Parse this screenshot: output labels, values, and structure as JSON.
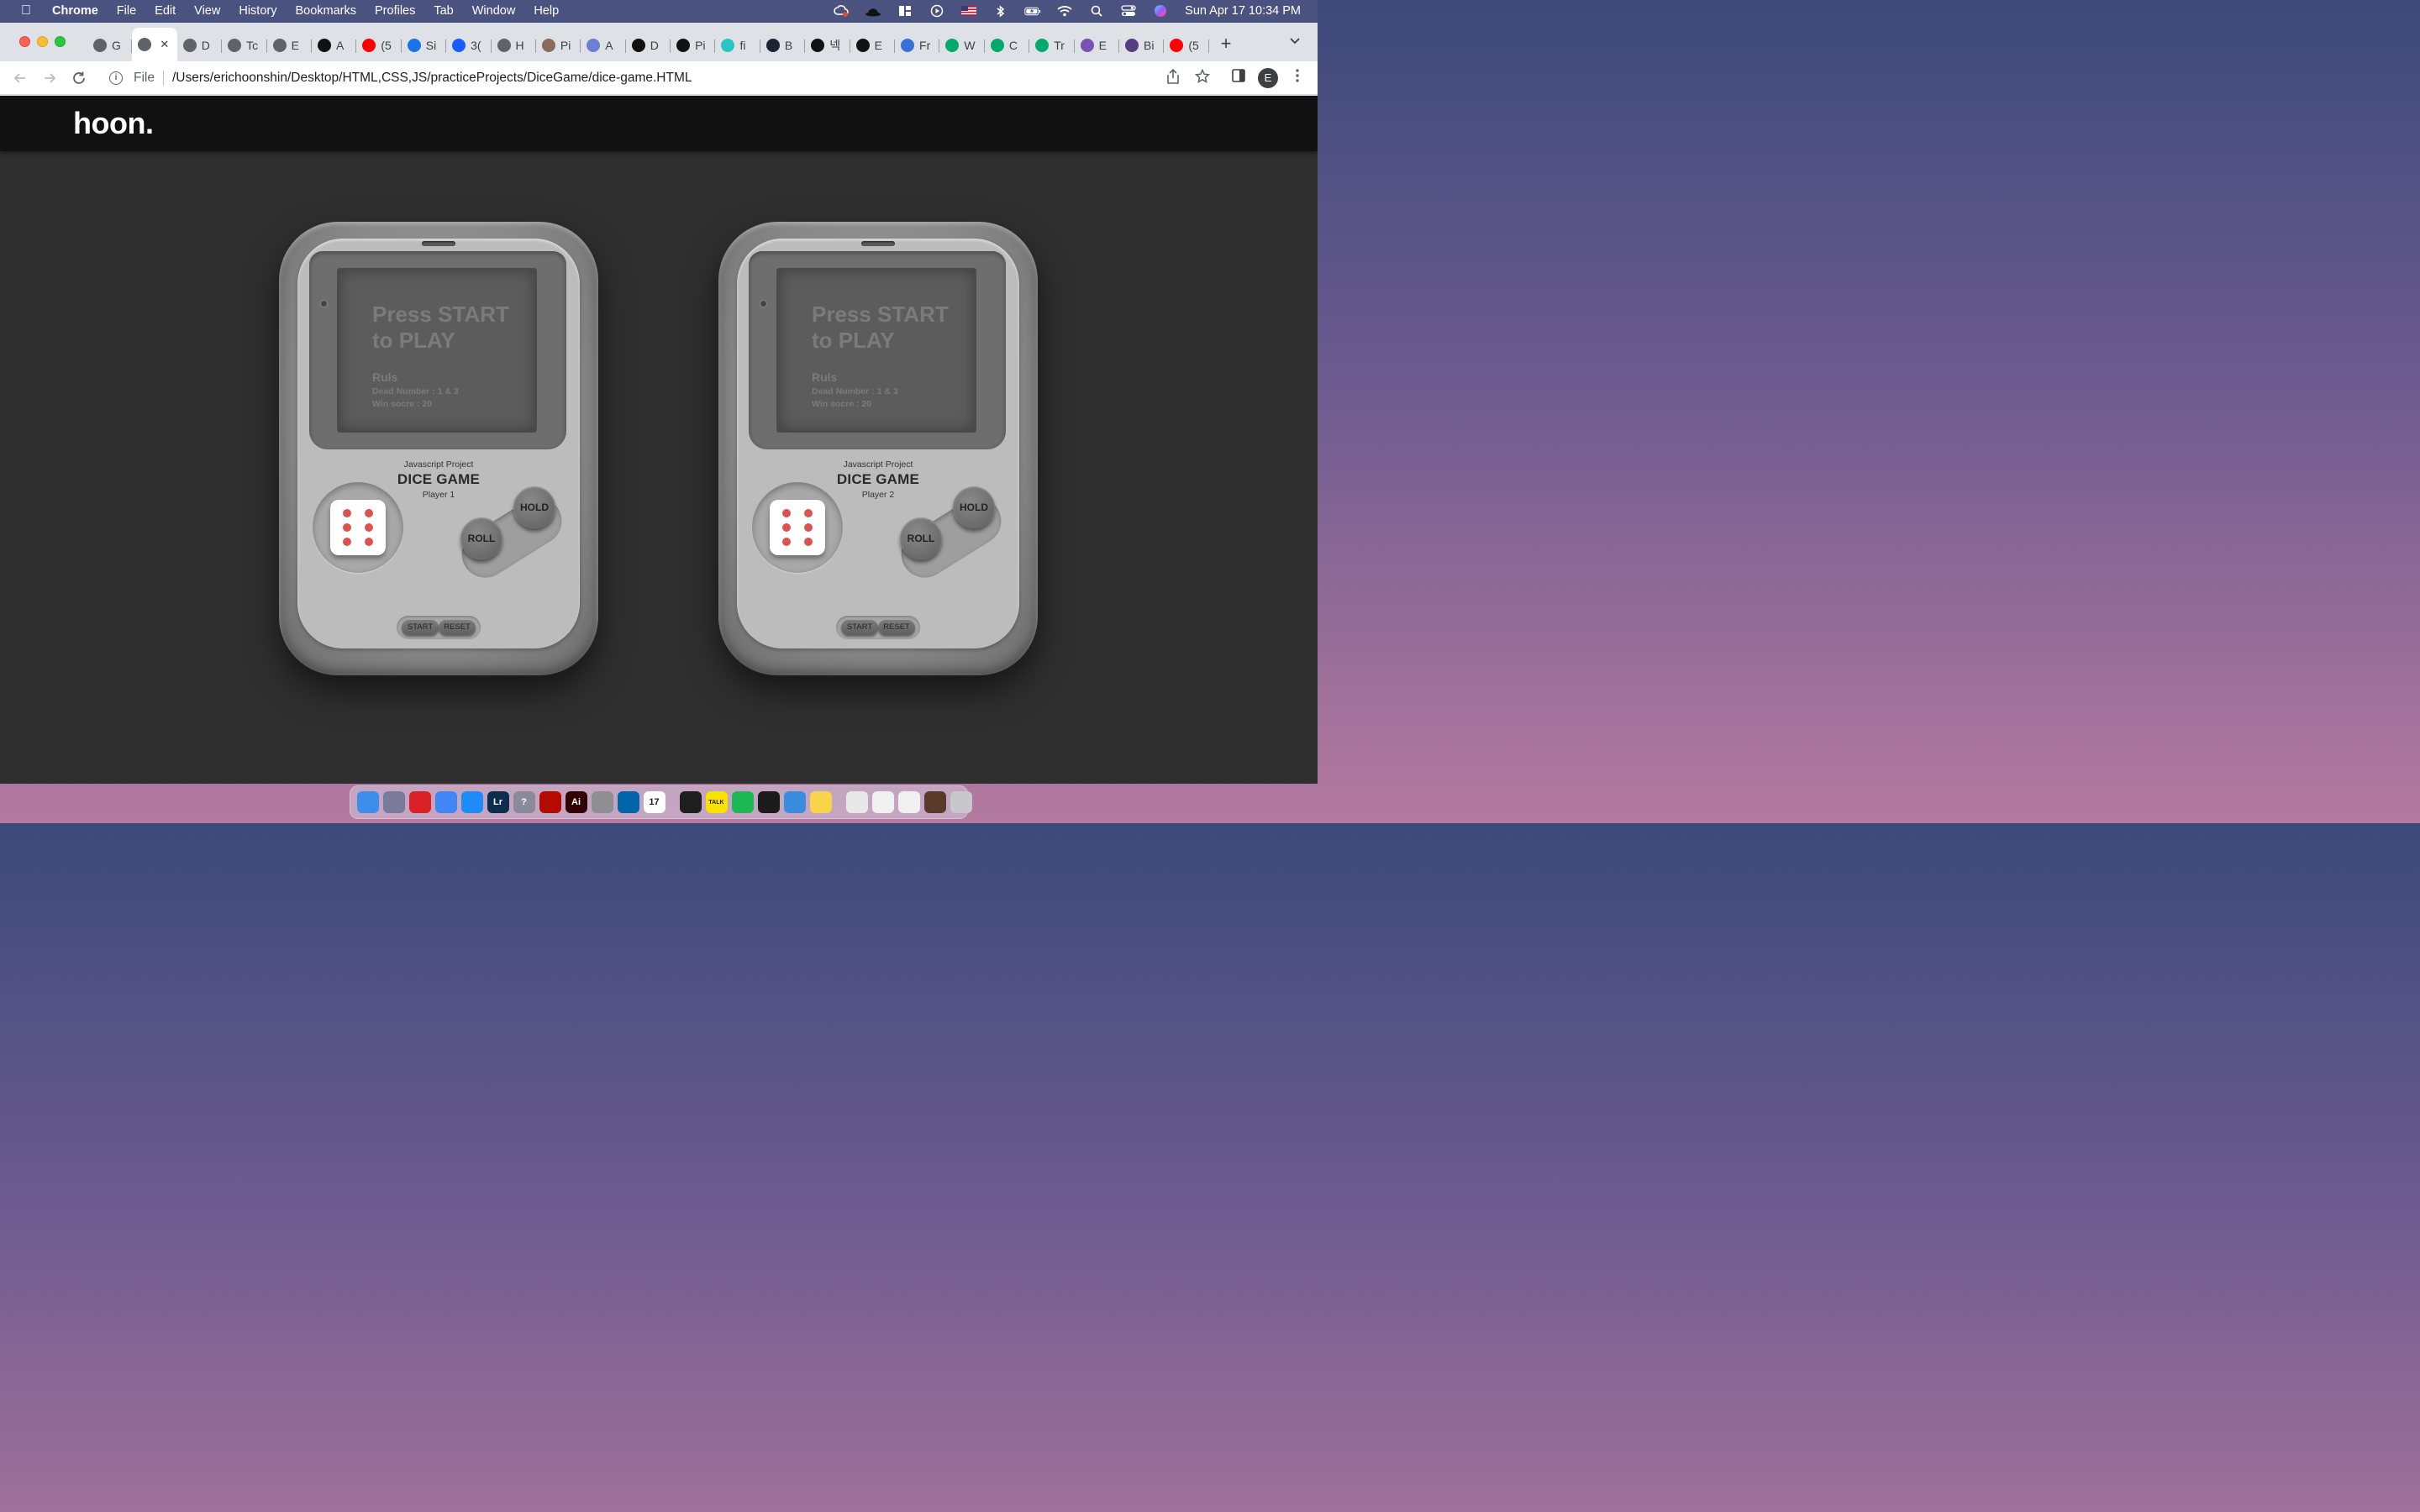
{
  "menubar": {
    "app_name": "Chrome",
    "items": [
      "File",
      "Edit",
      "View",
      "History",
      "Bookmarks",
      "Profiles",
      "Tab",
      "Window",
      "Help"
    ],
    "clock": "Sun Apr 17  10:34 PM"
  },
  "browser": {
    "tabs": [
      {
        "label": "G",
        "icon": "globe-icon",
        "color": "#5f6368"
      },
      {
        "label": "",
        "icon": "globe-icon",
        "color": "#5f6368",
        "active": true
      },
      {
        "label": "D",
        "icon": "globe-icon",
        "color": "#5f6368"
      },
      {
        "label": "Tc",
        "icon": "globe-icon",
        "color": "#5f6368"
      },
      {
        "label": "E",
        "icon": "globe-icon",
        "color": "#5f6368"
      },
      {
        "label": "A",
        "icon": "bars-icon",
        "color": "#111111"
      },
      {
        "label": "(5",
        "icon": "youtube-icon",
        "color": "#ff0000"
      },
      {
        "label": "Si",
        "icon": "flag-icon",
        "color": "#1a73e8"
      },
      {
        "label": "3(",
        "icon": "diamond-icon",
        "color": "#1a5cff"
      },
      {
        "label": "H",
        "icon": "globe-icon",
        "color": "#5f6368"
      },
      {
        "label": "Pi",
        "icon": "avatar-icon",
        "color": "#8a6b5a"
      },
      {
        "label": "A",
        "icon": "triangle-icon",
        "color": "#6b7fd7"
      },
      {
        "label": "D",
        "icon": "a-logo-icon",
        "color": "#111111"
      },
      {
        "label": "Pi",
        "icon": "cw-icon",
        "color": "#111111"
      },
      {
        "label": "fi",
        "icon": "hook-icon",
        "color": "#2bc4c4"
      },
      {
        "label": "B",
        "icon": "b-circle-icon",
        "color": "#1b2430"
      },
      {
        "label": "넥",
        "icon": "wix-icon",
        "color": "#111111"
      },
      {
        "label": "E",
        "icon": "wix-icon",
        "color": "#111111"
      },
      {
        "label": "Fr",
        "icon": "robot-icon",
        "color": "#3a6fd8"
      },
      {
        "label": "W",
        "icon": "w3-icon",
        "color": "#04aa6d"
      },
      {
        "label": "C",
        "icon": "w3-icon",
        "color": "#04aa6d"
      },
      {
        "label": "Tr",
        "icon": "w3-icon",
        "color": "#04aa6d"
      },
      {
        "label": "E",
        "icon": "bootstrap-icon",
        "color": "#7952b3"
      },
      {
        "label": "Bi",
        "icon": "bootstrap-icon",
        "color": "#563d7c"
      },
      {
        "label": "(5",
        "icon": "youtube-icon",
        "color": "#ff0000"
      }
    ],
    "url_scheme": "File",
    "url": "/Users/erichoonshin/Desktop/HTML,CSS,JS/practiceProjects/DiceGame/dice-game.HTML",
    "profile_initial": "E"
  },
  "site": {
    "logo": "hoon."
  },
  "devices": [
    {
      "headline": "Press START to PLAY",
      "rules_title": "Ruls",
      "rule_1": "Dead Number : 1 & 3",
      "rule_2": "Win socre : 20",
      "project_label": "Javascript Project",
      "game_title": "DICE GAME",
      "player": "Player 1",
      "die_value": 6,
      "hold_label": "HOLD",
      "roll_label": "ROLL",
      "start_label": "START",
      "reset_label": "RESET"
    },
    {
      "headline": "Press START to PLAY",
      "rules_title": "Ruls",
      "rule_1": "Dead Number : 1 & 3",
      "rule_2": "Win socre : 20",
      "project_label": "Javascript Project",
      "game_title": "DICE GAME",
      "player": "Player 2",
      "die_value": 6,
      "hold_label": "HOLD",
      "roll_label": "ROLL",
      "start_label": "START",
      "reset_label": "RESET"
    }
  ],
  "colors": {
    "pip": "#d9534f",
    "page_bg": "#2f2f2f",
    "header_bg": "#111111"
  },
  "dock": {
    "apps": [
      {
        "icon": "finder-icon",
        "color": "#3b8eea"
      },
      {
        "icon": "launchpad-icon",
        "color": "#7a7a9a"
      },
      {
        "icon": "creative-cloud-icon",
        "color": "#da1f26"
      },
      {
        "icon": "chrome-icon",
        "color": "#4285f4"
      },
      {
        "icon": "app-store-icon",
        "color": "#1d8cf8"
      },
      {
        "icon": "lightroom-icon",
        "color": "#0b2d4e",
        "text": "Lr"
      },
      {
        "icon": "help-icon",
        "color": "#8a8a9a",
        "text": "?"
      },
      {
        "icon": "acrobat-icon",
        "color": "#b30b00"
      },
      {
        "icon": "illustrator-icon",
        "color": "#330000",
        "text": "Ai"
      },
      {
        "icon": "system-preferences-icon",
        "color": "#8e8e93"
      },
      {
        "icon": "vscode-icon",
        "color": "#0065a9"
      },
      {
        "icon": "calendar-icon",
        "color": "#ffffff",
        "text": "17"
      },
      {
        "icon": "terminal-icon",
        "color": "#1e1e1e"
      },
      {
        "icon": "kakaotalk-icon",
        "color": "#fae100",
        "text": "TALK"
      },
      {
        "icon": "spotify-icon",
        "color": "#1db954"
      },
      {
        "icon": "iterm-icon",
        "color": "#1b1b1b"
      },
      {
        "icon": "mail-icon",
        "color": "#3a8dde"
      },
      {
        "icon": "notes-icon",
        "color": "#f7d44a"
      },
      {
        "icon": "preview-icon",
        "color": "#e8e8e8"
      },
      {
        "icon": "document-icon",
        "color": "#f0f0f0"
      },
      {
        "icon": "document-icon",
        "color": "#f0f0f0"
      },
      {
        "icon": "screenshot-icon",
        "color": "#5a3a2a"
      },
      {
        "icon": "trash-icon",
        "color": "#c8c8cc"
      }
    ]
  }
}
